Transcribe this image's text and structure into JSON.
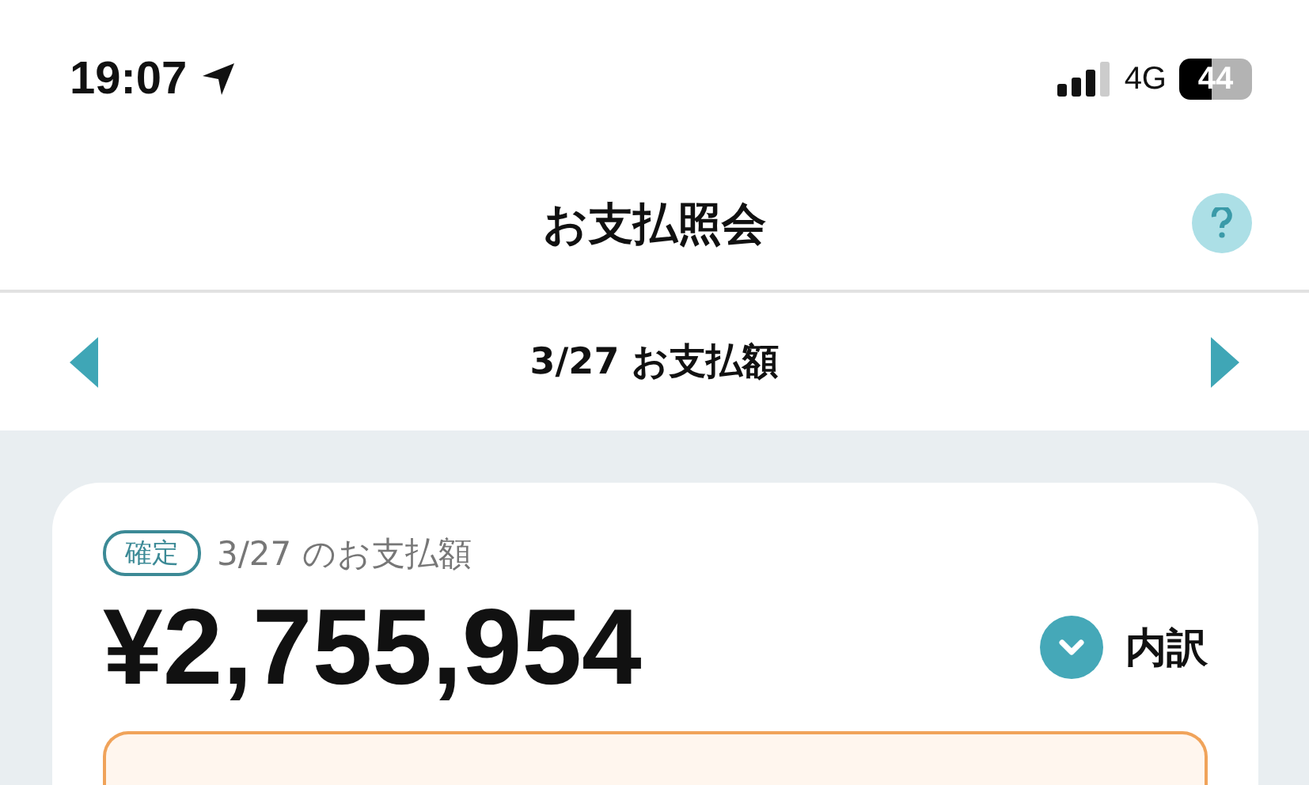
{
  "status_bar": {
    "time": "19:07",
    "network": "4G",
    "battery": "44"
  },
  "header": {
    "title": "お支払照会"
  },
  "date_nav": {
    "label": "3/27 お支払額"
  },
  "card": {
    "badge": "確定",
    "caption": "3/27 のお支払額",
    "amount": "¥2,755,954",
    "breakdown": "内訳"
  }
}
